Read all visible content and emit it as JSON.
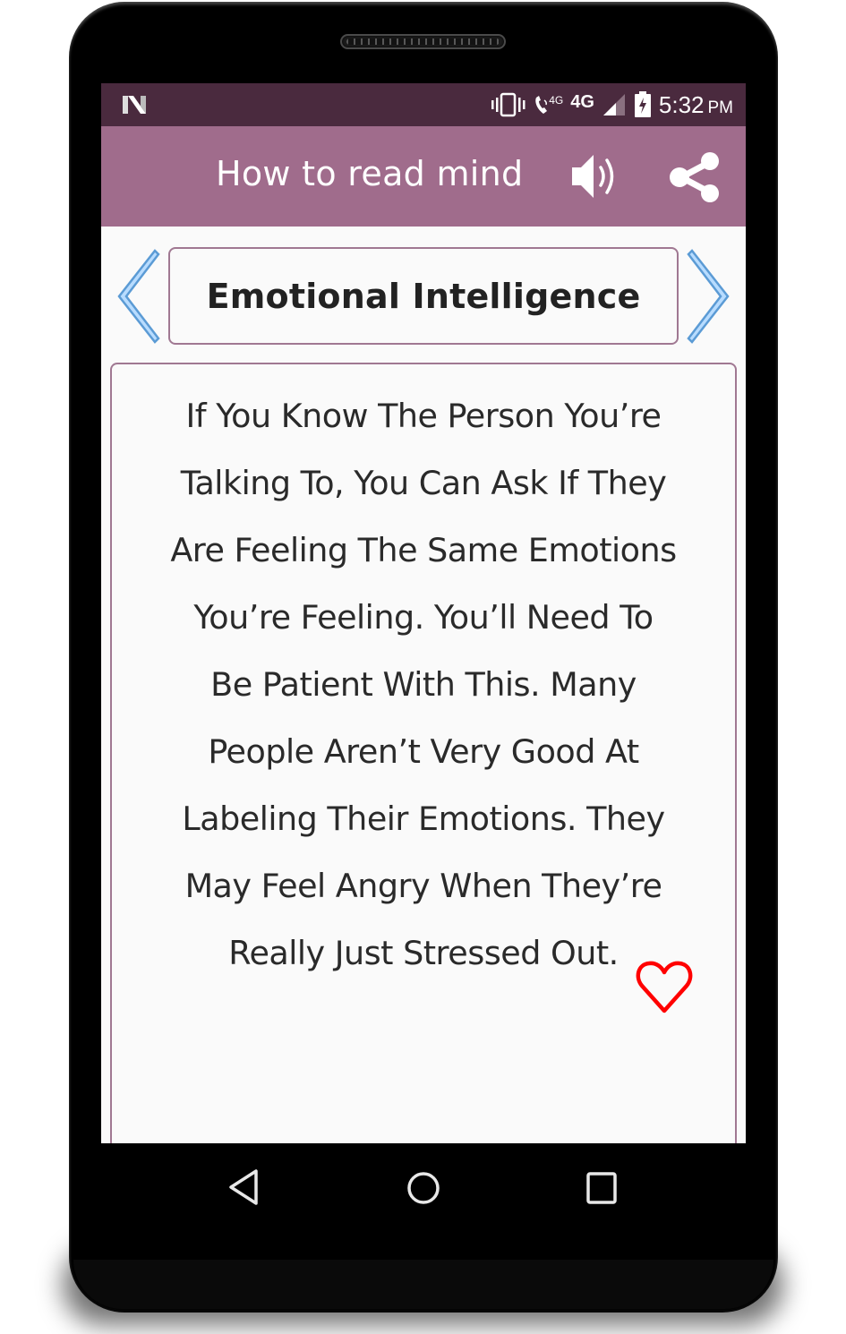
{
  "status_bar": {
    "notification_icon": "n-logo-icon",
    "icons": [
      "vibrate-icon",
      "volte-call-icon",
      "signal-icon",
      "battery-charging-icon"
    ],
    "call_network_label": "4G",
    "network_label": "4G",
    "time": "5:32",
    "ampm": "PM"
  },
  "app_bar": {
    "title": "How to read mind",
    "speaker_icon": "volume-icon",
    "share_icon": "share-icon",
    "color": "#a06c8c"
  },
  "topic": {
    "title": "Emotional Intelligence",
    "prev_icon": "chevron-left-icon",
    "next_icon": "chevron-right-icon",
    "arrow_color": "#5b9bd5"
  },
  "content": {
    "lines": [
      "If You Know The Person You’re",
      "Talking To, You Can Ask If They",
      "Are Feeling The Same Emotions",
      "You’re Feeling. You’ll Need To",
      "Be Patient With This. Many",
      "People Aren’t Very Good At",
      "Labeling Their Emotions. They",
      "May Feel Angry When They’re",
      "Really Just Stressed Out."
    ],
    "favorite_icon": "heart-outline-icon",
    "favorite_color": "#ff0000"
  },
  "nav_bar": {
    "back": "back-icon",
    "home": "home-icon",
    "recents": "recents-icon"
  }
}
